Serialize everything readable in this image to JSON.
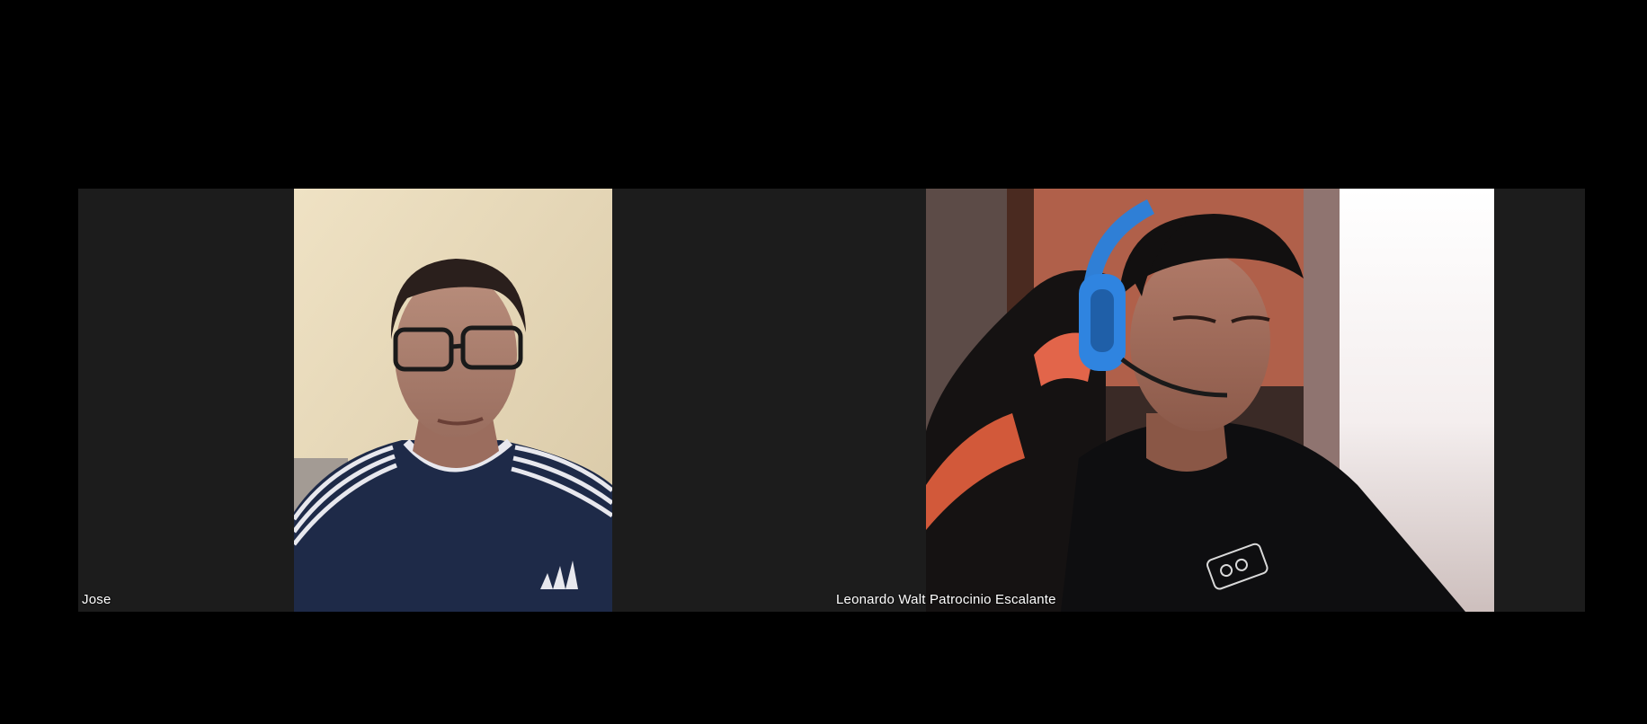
{
  "meeting": {
    "participants": [
      {
        "name": "Jose"
      },
      {
        "name": "Leonardo Walt Patrocinio Escalante"
      }
    ]
  },
  "colors": {
    "background": "#000000",
    "tile_background": "#1c1c1c",
    "label_text": "#ffffff"
  }
}
